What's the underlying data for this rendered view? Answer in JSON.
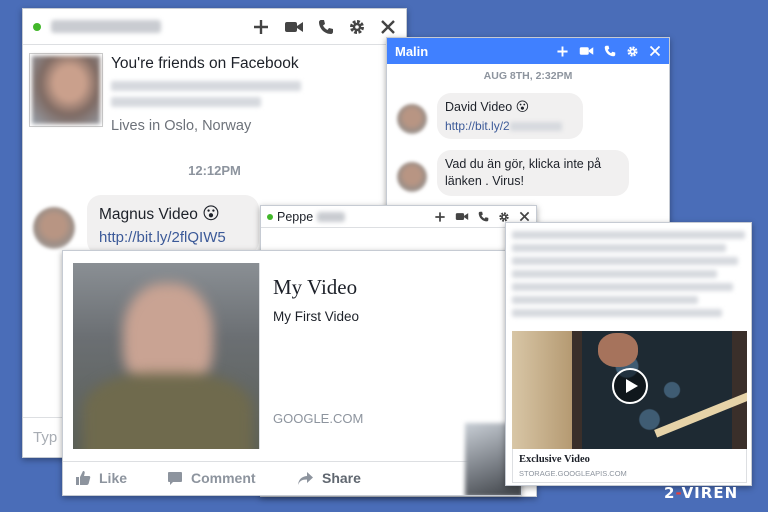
{
  "colors": {
    "background": "#4a6db8",
    "messenger_blue": "#4080ff",
    "link": "#3b5998",
    "online": "#42b72a"
  },
  "chatA": {
    "header": {
      "status": "online",
      "icons": [
        "plus-icon",
        "video-icon",
        "phone-icon",
        "gear-icon",
        "close-icon"
      ]
    },
    "profile": {
      "friends_text": "You're friends on Facebook",
      "location": "Lives in Oslo, Norway"
    },
    "timestamp": "12:12PM",
    "message": {
      "text": "Magnus Video",
      "emoji": "😮",
      "link": "http://bit.ly/2flQIW5"
    },
    "input_placeholder": "Typ"
  },
  "chatB": {
    "header": {
      "name": "Malin"
    },
    "date": "AUG 8TH, 2:32PM",
    "message1": {
      "text": "David Video",
      "emoji": "😮",
      "link": "http://bit.ly/2"
    },
    "message2": {
      "text": "Vad du än gör, klicka inte på länken . Virus!"
    }
  },
  "chatC": {
    "header": {
      "name": "Peppe"
    }
  },
  "preview": {
    "title": "My Video",
    "subtitle": "My First Video",
    "domain": "GOOGLE.COM",
    "actions": {
      "like": "Like",
      "comment": "Comment",
      "share": "Share"
    }
  },
  "adcard": {
    "title": "Exclusive Video",
    "domain": "STORAGE.GOOGLEAPIS.COM"
  },
  "watermark": {
    "left": "2",
    "sep": "-",
    "right": "VIREN"
  }
}
